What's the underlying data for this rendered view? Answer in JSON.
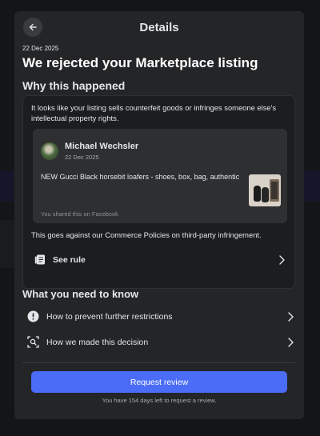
{
  "header": {
    "title": "Details",
    "back_icon": "arrow-left-icon"
  },
  "notice": {
    "date": "22 Dec 2025",
    "title": "We rejected your Marketplace listing"
  },
  "why": {
    "heading": "Why this happened",
    "reason": "It looks like your listing sells counterfeit goods or infringes someone else's intellectual property rights.",
    "post": {
      "author": "Michael Wechsler",
      "date": "22 Dec 2025",
      "text": "NEW Gucci Black horsebit loafers - shoes, box, bag, authentic",
      "shared_note": "You shared this on Facebook"
    },
    "policy": "This goes against our Commerce Policies on third-party infringement.",
    "see_rule": "See rule"
  },
  "know": {
    "heading": "What you need to know",
    "items": [
      {
        "label": "How to prevent further restrictions",
        "icon": "exclamation-circle-icon"
      },
      {
        "label": "How we made this decision",
        "icon": "search-scan-icon"
      }
    ]
  },
  "footer": {
    "button": "Request review",
    "days_left": "You have 154 days left to request a review."
  },
  "colors": {
    "accent": "#4a6cf6",
    "panel": "#242527",
    "card": "#2e2f31"
  }
}
